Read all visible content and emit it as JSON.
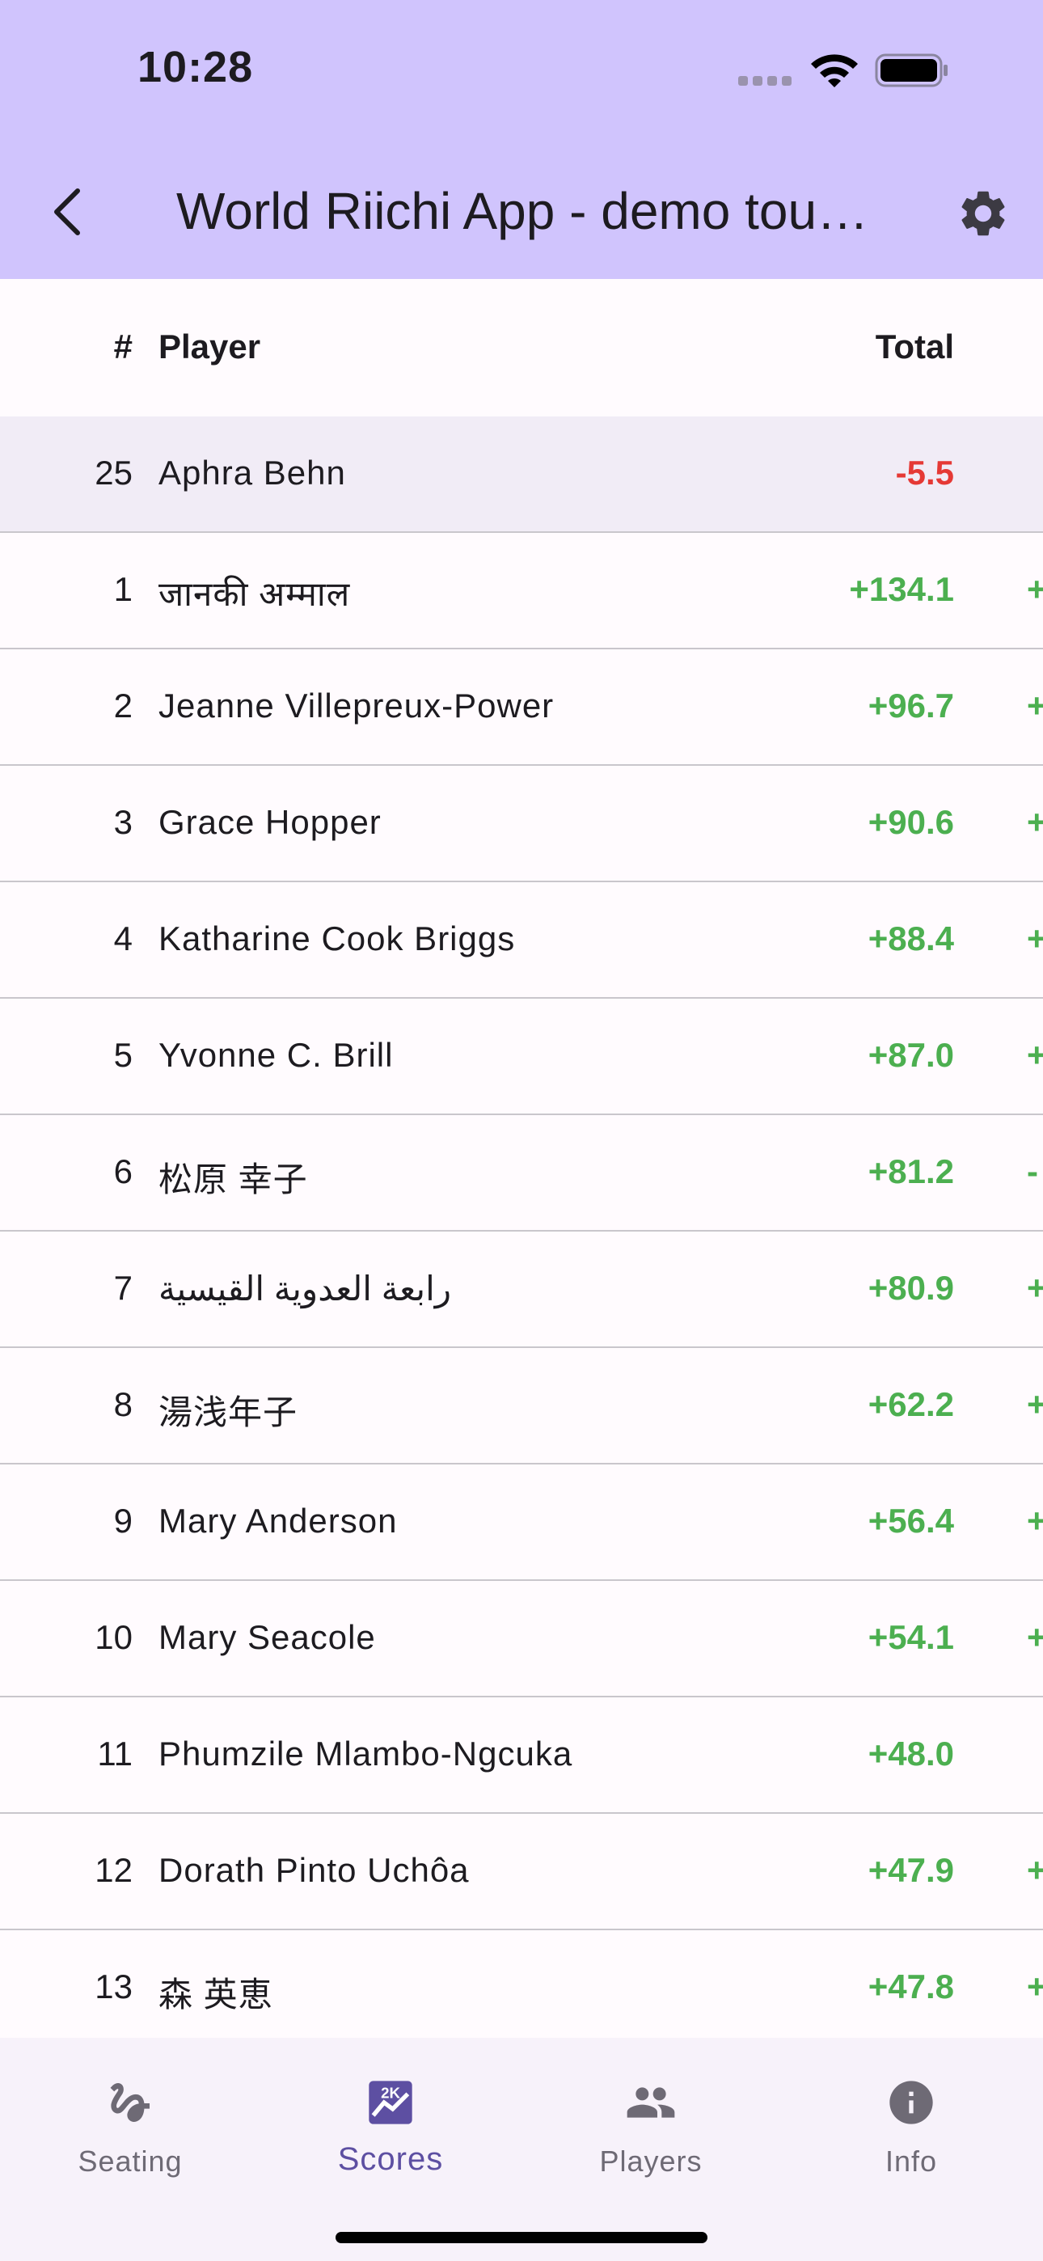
{
  "status_bar": {
    "time": "10:28"
  },
  "app_bar": {
    "title": "World Riichi App - demo tournament"
  },
  "table": {
    "headers": {
      "rank": "#",
      "player": "Player",
      "total": "Total"
    },
    "highlight_row": {
      "rank": "25",
      "name": "Aphra Behn",
      "total": "-5.5"
    },
    "rows": [
      {
        "rank": "1",
        "name": "जानकी अम्माल",
        "total": "+134.1",
        "extra": "+"
      },
      {
        "rank": "2",
        "name": "Jeanne Villepreux-Power",
        "total": "+96.7",
        "extra": "+"
      },
      {
        "rank": "3",
        "name": "Grace Hopper",
        "total": "+90.6",
        "extra": "+"
      },
      {
        "rank": "4",
        "name": "Katharine Cook Briggs",
        "total": "+88.4",
        "extra": "+"
      },
      {
        "rank": "5",
        "name": "Yvonne C. Brill",
        "total": "+87.0",
        "extra": "+"
      },
      {
        "rank": "6",
        "name": "松原 幸子",
        "total": "+81.2",
        "extra": "-"
      },
      {
        "rank": "7",
        "name": "رابعة العدوية القيسية",
        "total": "+80.9",
        "extra": "+"
      },
      {
        "rank": "8",
        "name": "湯浅年子",
        "total": "+62.2",
        "extra": "+"
      },
      {
        "rank": "9",
        "name": "Mary Anderson",
        "total": "+56.4",
        "extra": "+"
      },
      {
        "rank": "10",
        "name": "Mary Seacole",
        "total": "+54.1",
        "extra": "+"
      },
      {
        "rank": "11",
        "name": "Phumzile Mlambo-Ngcuka",
        "total": "+48.0",
        "extra": ""
      },
      {
        "rank": "12",
        "name": "Dorath Pinto Uchôa",
        "total": "+47.9",
        "extra": "+"
      },
      {
        "rank": "13",
        "name": "森 英恵",
        "total": "+47.8",
        "extra": "+"
      }
    ]
  },
  "nav": {
    "items": [
      {
        "label": "Seating",
        "icon": "seat-icon",
        "active": false
      },
      {
        "label": "Scores",
        "icon": "scores-icon",
        "active": true
      },
      {
        "label": "Players",
        "icon": "people-icon",
        "active": false
      },
      {
        "label": "Info",
        "icon": "info-icon",
        "active": false
      }
    ]
  },
  "colors": {
    "app_bar": "#d0c4fd",
    "positive": "#4caf50",
    "negative": "#e53935",
    "nav_active": "#5d4fa2",
    "nav_inactive": "#6e6a75"
  }
}
